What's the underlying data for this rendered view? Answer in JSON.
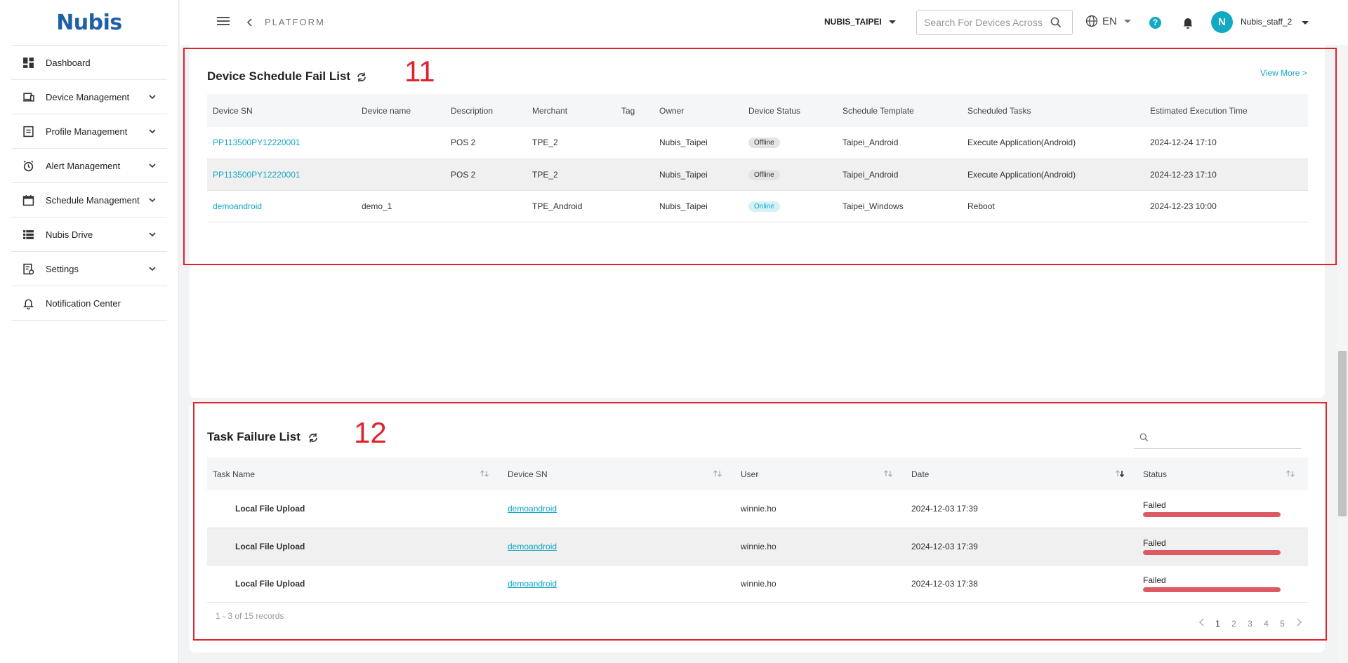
{
  "app": {
    "logo": "Nubis"
  },
  "sidebar": {
    "items": [
      {
        "label": "Dashboard",
        "icon": "dashboard-icon"
      },
      {
        "label": "Device Management",
        "icon": "device-icon"
      },
      {
        "label": "Profile Management",
        "icon": "profile-icon"
      },
      {
        "label": "Alert Management",
        "icon": "alarm-icon"
      },
      {
        "label": "Schedule Management",
        "icon": "calendar-icon"
      },
      {
        "label": "Nubis Drive",
        "icon": "drive-icon"
      },
      {
        "label": "Settings",
        "icon": "settings-icon"
      },
      {
        "label": "Notification Center",
        "icon": "bell-icon"
      }
    ]
  },
  "header": {
    "breadcrumb": "PLATFORM",
    "tenant": "NUBIS_TAIPEI",
    "search_placeholder": "Search For Devices Across",
    "language": "EN",
    "help": "?",
    "avatar_initial": "N",
    "username": "Nubis_staff_2"
  },
  "schedule_fail": {
    "annotation": "11",
    "title": "Device Schedule Fail List",
    "view_more": "View More >",
    "columns": [
      "Device SN",
      "Device name",
      "Description",
      "Merchant",
      "Tag",
      "Owner",
      "Device Status",
      "Schedule Template",
      "Scheduled Tasks",
      "Estimated Execution Time"
    ],
    "rows": [
      {
        "sn": "PP113500PY12220001",
        "name": "",
        "description": "POS 2",
        "merchant": "TPE_2",
        "tag": "",
        "owner": "Nubis_Taipei",
        "status": "Offline",
        "template": "Taipei_Android",
        "task": "Execute Application(Android)",
        "time": "2024-12-24 17:10"
      },
      {
        "sn": "PP113500PY12220001",
        "name": "",
        "description": "POS 2",
        "merchant": "TPE_2",
        "tag": "",
        "owner": "Nubis_Taipei",
        "status": "Offline",
        "template": "Taipei_Android",
        "task": "Execute Application(Android)",
        "time": "2024-12-23 17:10"
      },
      {
        "sn": "demoandroid",
        "name": "demo_1",
        "description": "",
        "merchant": "TPE_Android",
        "tag": "",
        "owner": "Nubis_Taipei",
        "status": "Online",
        "template": "Taipei_Windows",
        "task": "Reboot",
        "time": "2024-12-23 10:00"
      }
    ]
  },
  "task_failure": {
    "annotation": "12",
    "title": "Task Failure List",
    "columns": [
      "Task Name",
      "Device SN",
      "User",
      "Date",
      "Status"
    ],
    "rows": [
      {
        "task": "Local File Upload",
        "sn": "demoandroid",
        "user": "winnie.ho",
        "date": "2024-12-03 17:39",
        "status": "Failed",
        "progress": 1.0
      },
      {
        "task": "Local File Upload",
        "sn": "demoandroid",
        "user": "winnie.ho",
        "date": "2024-12-03 17:39",
        "status": "Failed",
        "progress": 1.0
      },
      {
        "task": "Local File Upload",
        "sn": "demoandroid",
        "user": "winnie.ho",
        "date": "2024-12-03 17:38",
        "status": "Failed",
        "progress": 1.0
      }
    ],
    "records": "1 - 3 of 15 records",
    "pages": [
      "1",
      "2",
      "3",
      "4",
      "5"
    ],
    "current_page": "1"
  },
  "colors": {
    "accent": "#13a8c3",
    "annotation": "#e0242e",
    "failed": "#dc5b63"
  }
}
